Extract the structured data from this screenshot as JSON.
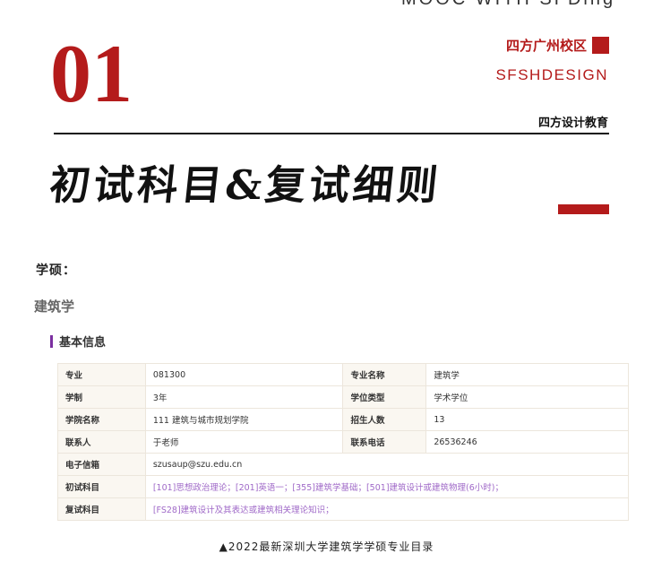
{
  "header": {
    "top_text": "MOOC WITH SFDing",
    "number": "01",
    "brand_cn": "四方广州校区",
    "brand_en": "SFSHDESIGN",
    "org": "四方设计教育",
    "title": "初试科目&复试细则",
    "accent_color": "#b41b1b"
  },
  "degree_label": "学硕：",
  "major_title": "建筑学",
  "section": {
    "title": "基本信息",
    "accent_color": "#7b2fa0"
  },
  "table": {
    "rows": [
      {
        "l1": "专业",
        "v1": "081300",
        "l2": "专业名称",
        "v2": "建筑学"
      },
      {
        "l1": "学制",
        "v1": "3年",
        "l2": "学位类型",
        "v2": "学术学位"
      },
      {
        "l1": "学院名称",
        "v1": "111 建筑与城市规划学院",
        "l2": "招生人数",
        "v2": "13"
      },
      {
        "l1": "联系人",
        "v1": "于老师",
        "l2": "联系电话",
        "v2": "26536246"
      }
    ],
    "email": {
      "label": "电子信箱",
      "value": "szusaup@szu.edu.cn"
    },
    "exam": {
      "label": "初试科目",
      "value": "[101]思想政治理论；[201]英语一；[355]建筑学基础；[501]建筑设计或建筑物理(6小时)；"
    },
    "retest": {
      "label": "复试科目",
      "value": "[FS28]建筑设计及其表达或建筑相关理论知识；"
    }
  },
  "caption": "▲2022最新深圳大学建筑学学硕专业目录"
}
